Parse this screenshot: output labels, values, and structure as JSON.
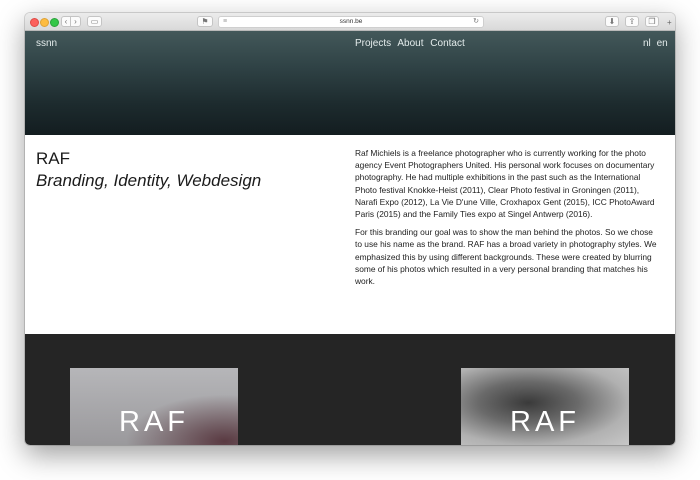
{
  "browser": {
    "url": "ssnn.be"
  },
  "site": {
    "logo": "ssnn",
    "nav": [
      "Projects",
      "About",
      "Contact"
    ],
    "languages": [
      "nl",
      "en"
    ]
  },
  "project": {
    "name": "RAF",
    "tags": "Branding, Identity, Webdesign",
    "paragraphs": [
      "Raf Michiels is a freelance photographer who is currently working for the photo agency Event Photographers United. His personal work focuses on documentary photography. He had multiple exhibitions in the past such as the International Photo festival Knokke-Heist (2011), Clear Photo festival in Groningen (2011), Narafi Expo (2012), La Vie D'une Ville, Croxhapox Gent (2015), ICC PhotoAward Paris (2015) and the Family Ties expo at Singel Antwerp (2016).",
      "For this branding our goal was to show the man behind the photos. So we chose to use his name as the brand. RAF has a broad variety in photography styles. We emphasized this by using different backgrounds. These were created by blurring some of his photos which resulted in a very personal branding that matches his work."
    ]
  },
  "gallery": {
    "tiles": [
      {
        "word": "RAF"
      },
      {
        "word": "RAF"
      }
    ]
  },
  "icons": {
    "back": "chevron-left-icon",
    "forward": "chevron-right-icon",
    "sidebar": "sidebar-icon",
    "reader": "reader-icon",
    "reload": "reload-icon",
    "download": "download-icon",
    "share": "share-icon",
    "tabs": "tabs-icon",
    "new_tab": "plus-icon"
  }
}
